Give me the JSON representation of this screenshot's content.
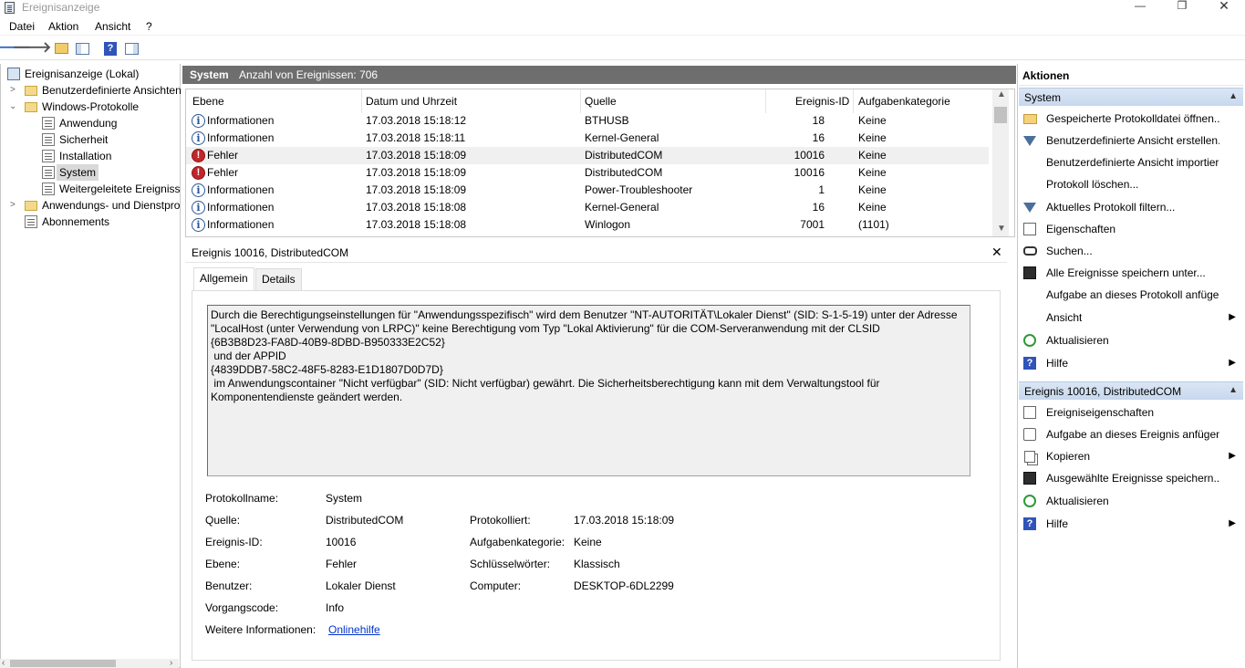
{
  "window": {
    "title": "Ereignisanzeige"
  },
  "menu": [
    "Datei",
    "Aktion",
    "Ansicht",
    "?"
  ],
  "tree": {
    "root": "Ereignisanzeige (Lokal)",
    "custom_views": "Benutzerdefinierte Ansichten",
    "windows_logs": "Windows-Protokolle",
    "logs": [
      "Anwendung",
      "Sicherheit",
      "Installation",
      "System",
      "Weitergeleitete Ereignisse"
    ],
    "app_services": "Anwendungs- und Dienstprotokolle",
    "subscriptions": "Abonnements",
    "selected": "System"
  },
  "list": {
    "title": "System",
    "count_label": "Anzahl von Ereignissen: 706",
    "columns": [
      "Ebene",
      "Datum und Uhrzeit",
      "Quelle",
      "Ereignis-ID",
      "Aufgabenkategorie"
    ],
    "rows": [
      {
        "level": "Informationen",
        "type": "info",
        "date": "17.03.2018 15:18:12",
        "source": "BTHUSB",
        "id": "18",
        "category": "Keine"
      },
      {
        "level": "Informationen",
        "type": "info",
        "date": "17.03.2018 15:18:11",
        "source": "Kernel-General",
        "id": "16",
        "category": "Keine"
      },
      {
        "level": "Fehler",
        "type": "error",
        "date": "17.03.2018 15:18:09",
        "source": "DistributedCOM",
        "id": "10016",
        "category": "Keine",
        "selected": true
      },
      {
        "level": "Fehler",
        "type": "error",
        "date": "17.03.2018 15:18:09",
        "source": "DistributedCOM",
        "id": "10016",
        "category": "Keine"
      },
      {
        "level": "Informationen",
        "type": "info",
        "date": "17.03.2018 15:18:09",
        "source": "Power-Troubleshooter",
        "id": "1",
        "category": "Keine"
      },
      {
        "level": "Informationen",
        "type": "info",
        "date": "17.03.2018 15:18:08",
        "source": "Kernel-General",
        "id": "16",
        "category": "Keine"
      },
      {
        "level": "Informationen",
        "type": "info",
        "date": "17.03.2018 15:18:08",
        "source": "Winlogon",
        "id": "7001",
        "category": "(1101)"
      }
    ]
  },
  "detail": {
    "title": "Ereignis 10016, DistributedCOM",
    "tabs": [
      "Allgemein",
      "Details"
    ],
    "description": "Durch die Berechtigungseinstellungen für \"Anwendungsspezifisch\" wird dem Benutzer \"NT-AUTORITÄT\\Lokaler Dienst\" (SID: S-1-5-19) unter der Adresse \"LocalHost (unter Verwendung von LRPC)\" keine Berechtigung vom Typ \"Lokal Aktivierung\" für die COM-Serveranwendung mit der CLSID \n{6B3B8D23-FA8D-40B9-8DBD-B950333E2C52}\n und der APPID \n{4839DDB7-58C2-48F5-8283-E1D1807D0D7D}\n im Anwendungscontainer \"Nicht verfügbar\" (SID: Nicht verfügbar) gewährt. Die Sicherheitsberechtigung kann mit dem Verwaltungstool für Komponentendienste geändert werden.",
    "labels": {
      "log_name": "Protokollname:",
      "source": "Quelle:",
      "event_id": "Ereignis-ID:",
      "level": "Ebene:",
      "user": "Benutzer:",
      "opcode": "Vorgangscode:",
      "more_info": "Weitere Informationen:",
      "logged": "Protokolliert:",
      "task_category": "Aufgabenkategorie:",
      "keywords": "Schlüsselwörter:",
      "computer": "Computer:"
    },
    "values": {
      "log_name": "System",
      "source": "DistributedCOM",
      "event_id": "10016",
      "level": "Fehler",
      "user": "Lokaler Dienst",
      "opcode": "Info",
      "more_info": "Onlinehilfe",
      "logged": "17.03.2018 15:18:09",
      "task_category": "Keine",
      "keywords": "Klassisch",
      "computer": "DESKTOP-6DL2299"
    }
  },
  "actions": {
    "title": "Aktionen",
    "section1": {
      "title": "System",
      "items": [
        {
          "label": "Gespeicherte Protokolldatei öffnen...",
          "icon": "folder-open-icon"
        },
        {
          "label": "Benutzerdefinierte Ansicht erstellen...",
          "icon": "filter-create-icon"
        },
        {
          "label": "Benutzerdefinierte Ansicht importieren...",
          "icon": ""
        },
        {
          "label": "Protokoll löschen...",
          "icon": ""
        },
        {
          "label": "Aktuelles Protokoll filtern...",
          "icon": "filter-icon"
        },
        {
          "label": "Eigenschaften",
          "icon": "properties-icon"
        },
        {
          "label": "Suchen...",
          "icon": "binoculars-icon"
        },
        {
          "label": "Alle Ereignisse speichern unter...",
          "icon": "save-icon"
        },
        {
          "label": "Aufgabe an dieses Protokoll anfügen...",
          "icon": ""
        },
        {
          "label": "Ansicht",
          "icon": "",
          "submenu": true
        },
        {
          "label": "Aktualisieren",
          "icon": "refresh-icon"
        },
        {
          "label": "Hilfe",
          "icon": "help-icon",
          "submenu": true
        }
      ]
    },
    "section2": {
      "title": "Ereignis 10016, DistributedCOM",
      "items": [
        {
          "label": "Ereigniseigenschaften",
          "icon": "event-properties-icon"
        },
        {
          "label": "Aufgabe an dieses Ereignis anfügen...",
          "icon": "task-icon"
        },
        {
          "label": "Kopieren",
          "icon": "copy-icon",
          "submenu": true
        },
        {
          "label": "Ausgewählte Ereignisse speichern...",
          "icon": "save-icon"
        },
        {
          "label": "Aktualisieren",
          "icon": "refresh-icon"
        },
        {
          "label": "Hilfe",
          "icon": "help-icon",
          "submenu": true
        }
      ]
    }
  }
}
